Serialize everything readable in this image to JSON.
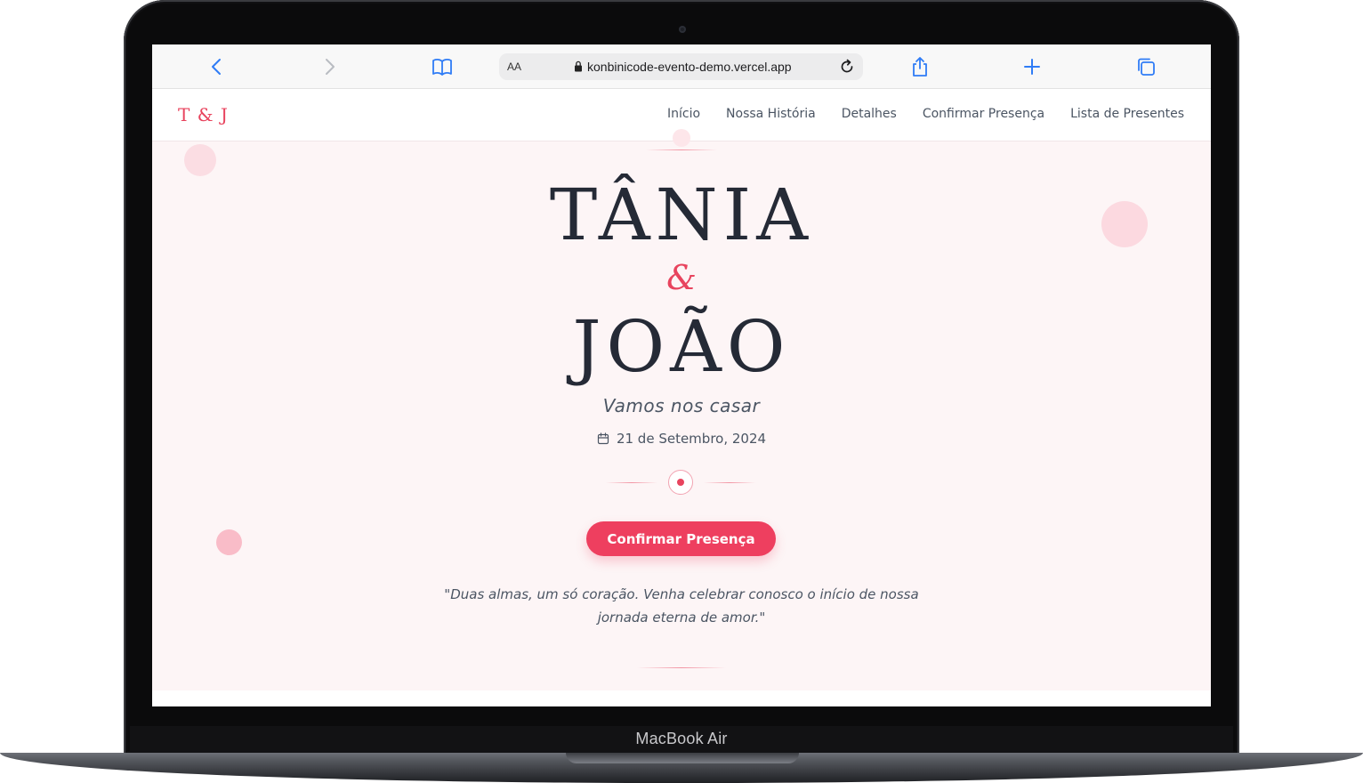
{
  "device": {
    "label": "MacBook Air"
  },
  "browser": {
    "aa_label": "AA",
    "url": "konbinicode-evento-demo.vercel.app",
    "icons": {
      "back": "chevron-left-icon",
      "forward": "chevron-right-icon",
      "bookmarks": "book-icon",
      "reload": "reload-icon",
      "share": "share-icon",
      "new_tab": "plus-icon",
      "tabs": "tabs-icon"
    }
  },
  "site": {
    "logo": "T & J",
    "nav": [
      "Início",
      "Nossa História",
      "Detalhes",
      "Confirmar Presença",
      "Lista de Presentes"
    ]
  },
  "hero": {
    "name_one": "TÂNIA",
    "ampersand": "&",
    "name_two": "JOÃO",
    "subtitle": "Vamos nos casar",
    "date": "21 de Setembro, 2024",
    "cta_label": "Confirmar Presença",
    "quote_line_1": "\"Duas almas, um só coração. Venha celebrar conosco o início de nossa",
    "quote_line_2": "jornada eterna de amor.\""
  },
  "colors": {
    "accent": "#ee3f5f",
    "hero_bg": "#fdf5f6",
    "heading": "#252a36",
    "safari_blue": "#2f7cf6"
  }
}
